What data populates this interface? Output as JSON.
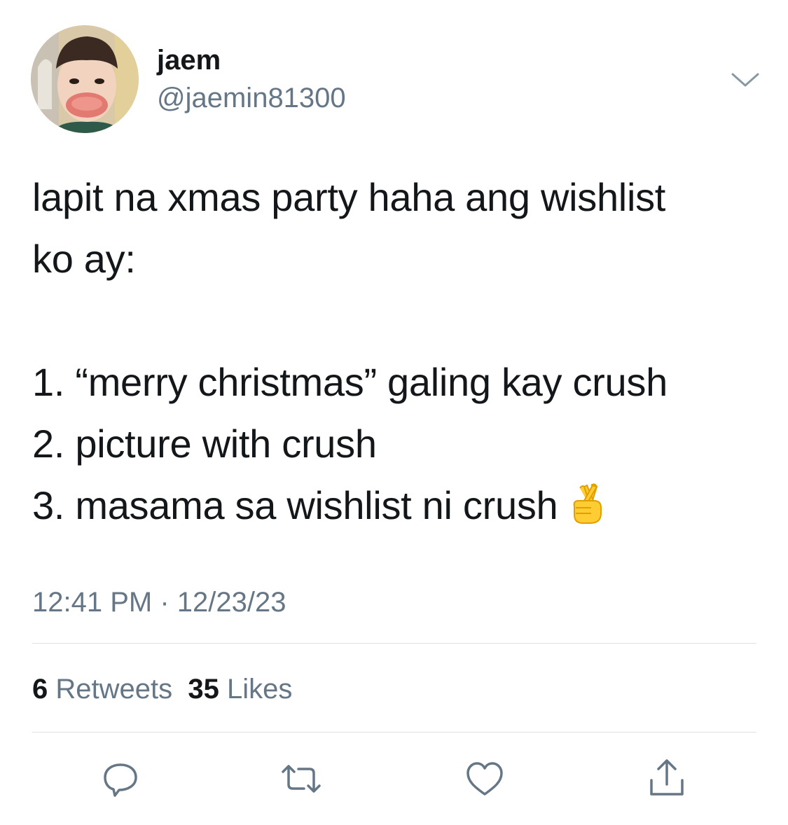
{
  "tweet": {
    "author": {
      "display_name": "jaem",
      "handle": "@jaemin81300"
    },
    "text_lines": [
      "lapit na xmas party haha ang wishlist",
      "ko ay:",
      "",
      "1. “merry christmas” galing kay crush",
      "2. picture with crush",
      "3. masama sa wishlist ni crush"
    ],
    "emoji": "crossed-fingers",
    "timestamp": "12:41 PM · 12/23/23",
    "stats": {
      "retweets_count": "6",
      "retweets_label": "Retweets",
      "likes_count": "35",
      "likes_label": "Likes"
    }
  },
  "icons": {
    "more": "chevron-down-icon",
    "reply": "reply-icon",
    "retweet": "retweet-icon",
    "like": "heart-icon",
    "share": "share-icon"
  },
  "colors": {
    "text_primary": "#14171a",
    "text_secondary": "#657786",
    "divider": "#dfe3e6",
    "icon": "#657786"
  }
}
